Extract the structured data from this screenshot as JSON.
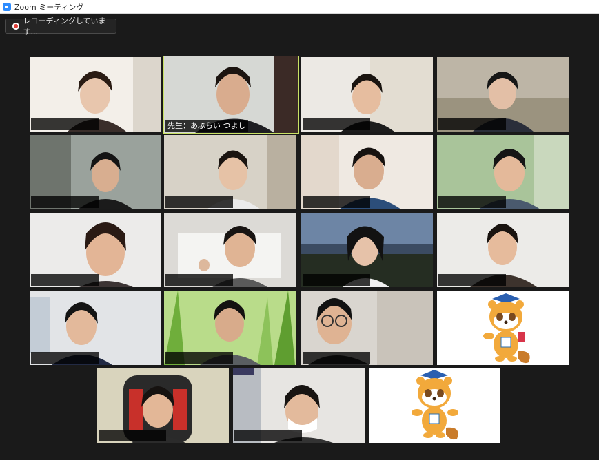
{
  "window": {
    "title": "Zoom ミーティング",
    "app_icon": "zoom-camera-icon"
  },
  "recording": {
    "label": "レコーディングしています...",
    "dot_color": "#e0403a"
  },
  "accent_active_color": "#c9e265",
  "tiles": [
    {
      "name": ""
    },
    {
      "name": "先生：あぶらい つよし",
      "active": true
    },
    {
      "name": ""
    },
    {
      "name": ""
    },
    {
      "name": ""
    },
    {
      "name": ""
    },
    {
      "name": ""
    },
    {
      "name": ""
    },
    {
      "name": ""
    },
    {
      "name": ""
    },
    {
      "name": ""
    },
    {
      "name": ""
    },
    {
      "name": ""
    },
    {
      "name": ""
    },
    {
      "name": ""
    },
    {
      "name": "",
      "avatar": "tanuki-mascot"
    },
    {
      "name": ""
    },
    {
      "name": ""
    },
    {
      "name": "",
      "avatar": "tanuki-mascot"
    }
  ]
}
